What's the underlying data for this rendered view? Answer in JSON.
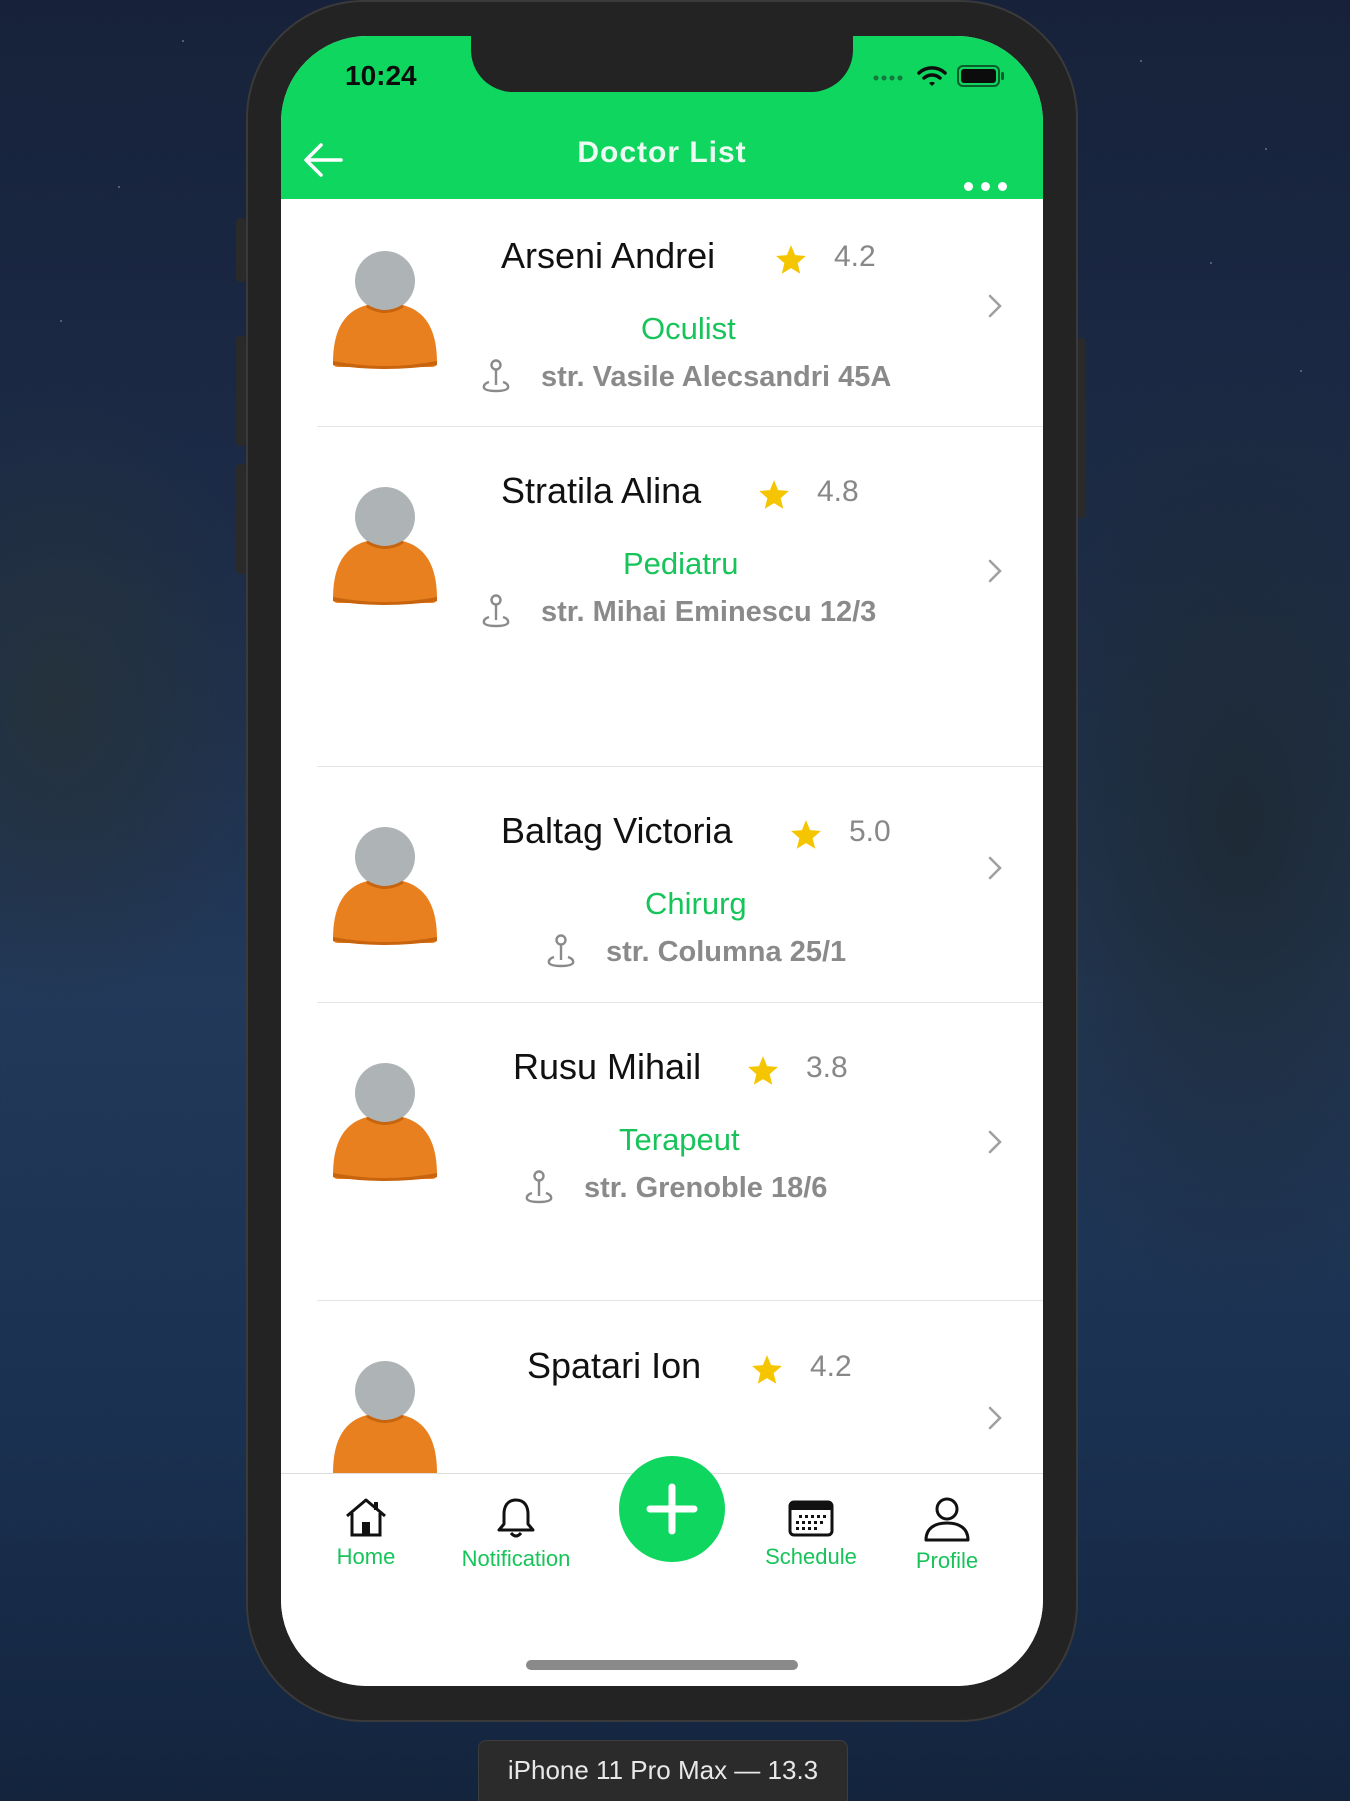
{
  "status_bar": {
    "time": "10:24"
  },
  "nav": {
    "title": "Doctor List"
  },
  "doctors": [
    {
      "name": "Arseni Andrei",
      "rating": "4.2",
      "specialty": "Oculist",
      "address": "str. Vasile Alecsandri 45A"
    },
    {
      "name": "Stratila Alina",
      "rating": "4.8",
      "specialty": "Pediatru",
      "address": "str. Mihai Eminescu 12/3"
    },
    {
      "name": "Baltag Victoria",
      "rating": "5.0",
      "specialty": "Chirurg",
      "address": "str. Columna 25/1"
    },
    {
      "name": "Rusu Mihail",
      "rating": "3.8",
      "specialty": "Terapeut",
      "address": "str. Grenoble 18/6"
    },
    {
      "name": "Spatari Ion",
      "rating": "4.2"
    }
  ],
  "tabbar": {
    "home": "Home",
    "notification": "Notification",
    "schedule": "Schedule",
    "profile": "Profile"
  },
  "device_label": "iPhone 11 Pro Max — 13.3",
  "colors": {
    "accent": "#0ED65E",
    "avatar_body": "#E8801F",
    "avatar_head": "#AEB4B6",
    "star": "#F5C600"
  },
  "icons": [
    "back-arrow-icon",
    "more-dots-icon",
    "star-icon",
    "location-pin-icon",
    "chevron-right-icon",
    "home-icon",
    "bell-icon",
    "plus-icon",
    "calendar-icon",
    "user-icon"
  ]
}
